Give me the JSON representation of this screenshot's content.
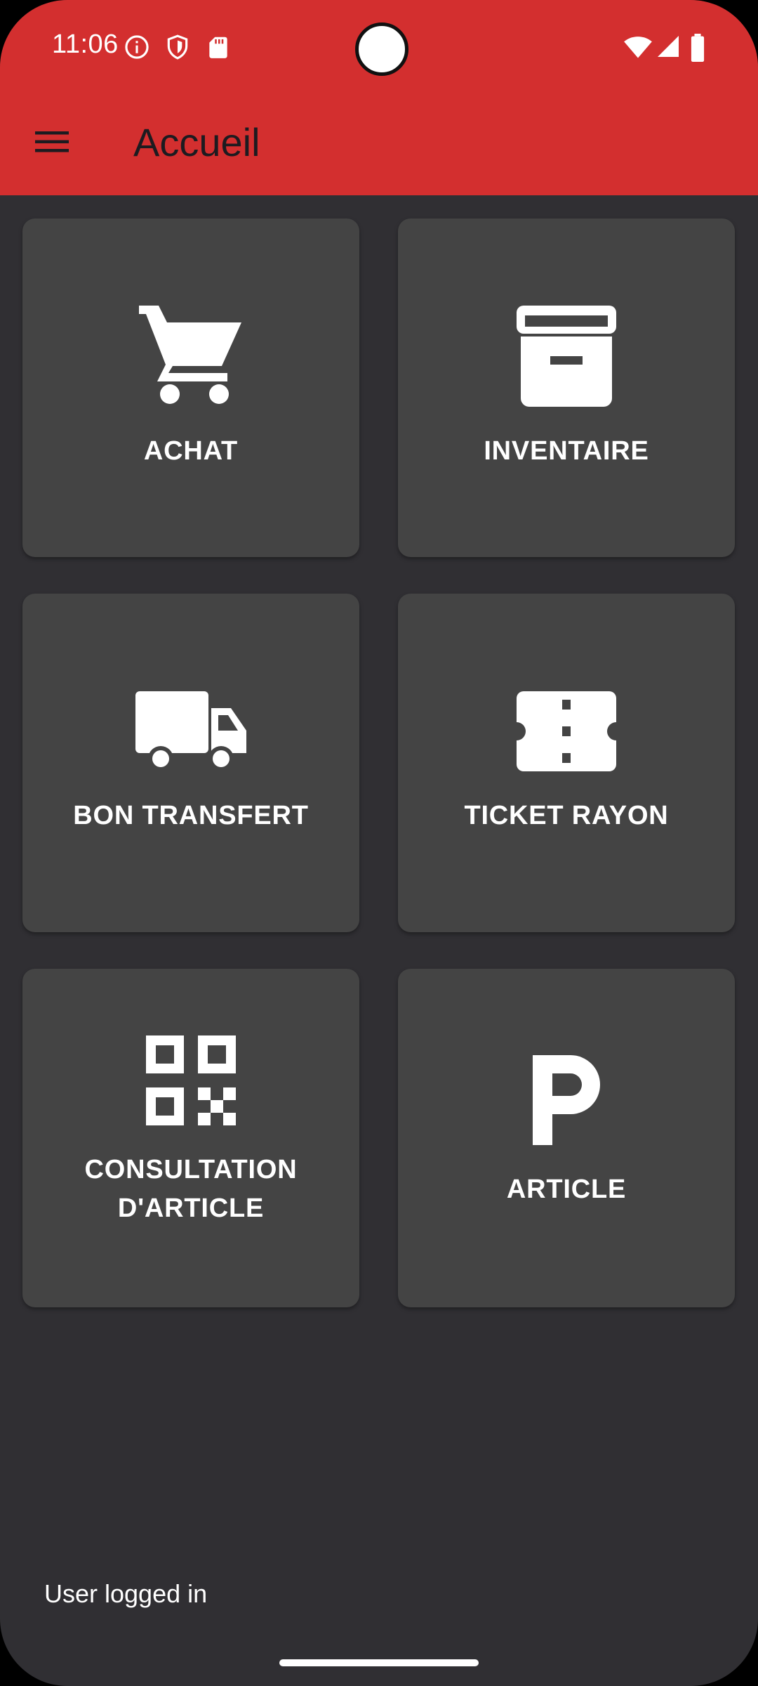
{
  "status_bar": {
    "time": "11:06",
    "icons": [
      "info-icon",
      "shield-icon",
      "sd-card-icon",
      "wifi-icon",
      "cell-signal-icon",
      "battery-icon"
    ]
  },
  "app_bar": {
    "title": "Accueil",
    "menu_icon": "menu-icon"
  },
  "tiles": [
    {
      "label": "ACHAT",
      "icon": "cart-icon"
    },
    {
      "label": "INVENTAIRE",
      "icon": "archive-box-icon"
    },
    {
      "label": "BON TRANSFERT",
      "icon": "truck-icon"
    },
    {
      "label": "TICKET RAYON",
      "icon": "ticket-icon"
    },
    {
      "label": "CONSULTATION D'ARTICLE",
      "icon": "qr-code-icon"
    },
    {
      "label": "ARTICLE",
      "icon": "letter-p-icon"
    }
  ],
  "footer": {
    "status_text": "User logged in"
  },
  "colors": {
    "app_bar": "#d32f2f",
    "background": "#302f33",
    "tile": "#444444"
  }
}
